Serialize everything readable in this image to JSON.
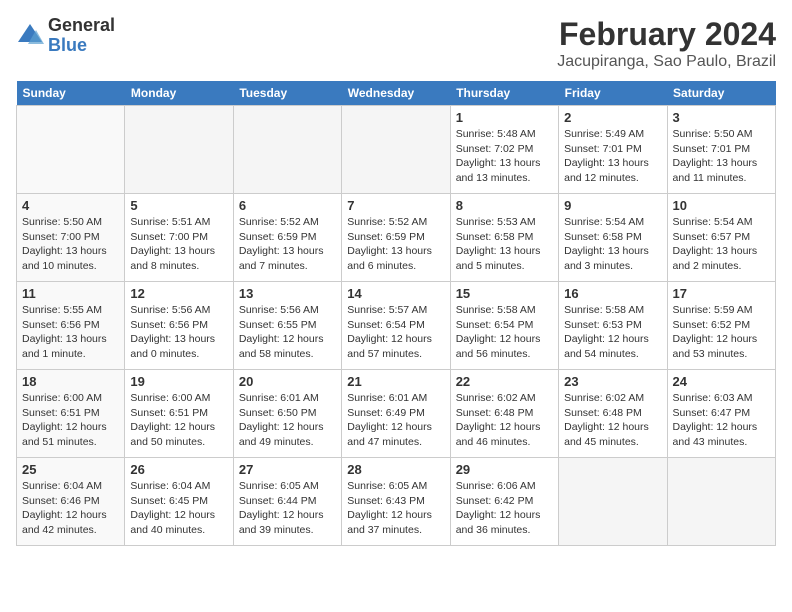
{
  "logo": {
    "general": "General",
    "blue": "Blue"
  },
  "title": "February 2024",
  "subtitle": "Jacupiranga, Sao Paulo, Brazil",
  "headers": [
    "Sunday",
    "Monday",
    "Tuesday",
    "Wednesday",
    "Thursday",
    "Friday",
    "Saturday"
  ],
  "weeks": [
    [
      {
        "day": "",
        "info": ""
      },
      {
        "day": "",
        "info": ""
      },
      {
        "day": "",
        "info": ""
      },
      {
        "day": "",
        "info": ""
      },
      {
        "day": "1",
        "info": "Sunrise: 5:48 AM\nSunset: 7:02 PM\nDaylight: 13 hours\nand 13 minutes."
      },
      {
        "day": "2",
        "info": "Sunrise: 5:49 AM\nSunset: 7:01 PM\nDaylight: 13 hours\nand 12 minutes."
      },
      {
        "day": "3",
        "info": "Sunrise: 5:50 AM\nSunset: 7:01 PM\nDaylight: 13 hours\nand 11 minutes."
      }
    ],
    [
      {
        "day": "4",
        "info": "Sunrise: 5:50 AM\nSunset: 7:00 PM\nDaylight: 13 hours\nand 10 minutes."
      },
      {
        "day": "5",
        "info": "Sunrise: 5:51 AM\nSunset: 7:00 PM\nDaylight: 13 hours\nand 8 minutes."
      },
      {
        "day": "6",
        "info": "Sunrise: 5:52 AM\nSunset: 6:59 PM\nDaylight: 13 hours\nand 7 minutes."
      },
      {
        "day": "7",
        "info": "Sunrise: 5:52 AM\nSunset: 6:59 PM\nDaylight: 13 hours\nand 6 minutes."
      },
      {
        "day": "8",
        "info": "Sunrise: 5:53 AM\nSunset: 6:58 PM\nDaylight: 13 hours\nand 5 minutes."
      },
      {
        "day": "9",
        "info": "Sunrise: 5:54 AM\nSunset: 6:58 PM\nDaylight: 13 hours\nand 3 minutes."
      },
      {
        "day": "10",
        "info": "Sunrise: 5:54 AM\nSunset: 6:57 PM\nDaylight: 13 hours\nand 2 minutes."
      }
    ],
    [
      {
        "day": "11",
        "info": "Sunrise: 5:55 AM\nSunset: 6:56 PM\nDaylight: 13 hours\nand 1 minute."
      },
      {
        "day": "12",
        "info": "Sunrise: 5:56 AM\nSunset: 6:56 PM\nDaylight: 13 hours\nand 0 minutes."
      },
      {
        "day": "13",
        "info": "Sunrise: 5:56 AM\nSunset: 6:55 PM\nDaylight: 12 hours\nand 58 minutes."
      },
      {
        "day": "14",
        "info": "Sunrise: 5:57 AM\nSunset: 6:54 PM\nDaylight: 12 hours\nand 57 minutes."
      },
      {
        "day": "15",
        "info": "Sunrise: 5:58 AM\nSunset: 6:54 PM\nDaylight: 12 hours\nand 56 minutes."
      },
      {
        "day": "16",
        "info": "Sunrise: 5:58 AM\nSunset: 6:53 PM\nDaylight: 12 hours\nand 54 minutes."
      },
      {
        "day": "17",
        "info": "Sunrise: 5:59 AM\nSunset: 6:52 PM\nDaylight: 12 hours\nand 53 minutes."
      }
    ],
    [
      {
        "day": "18",
        "info": "Sunrise: 6:00 AM\nSunset: 6:51 PM\nDaylight: 12 hours\nand 51 minutes."
      },
      {
        "day": "19",
        "info": "Sunrise: 6:00 AM\nSunset: 6:51 PM\nDaylight: 12 hours\nand 50 minutes."
      },
      {
        "day": "20",
        "info": "Sunrise: 6:01 AM\nSunset: 6:50 PM\nDaylight: 12 hours\nand 49 minutes."
      },
      {
        "day": "21",
        "info": "Sunrise: 6:01 AM\nSunset: 6:49 PM\nDaylight: 12 hours\nand 47 minutes."
      },
      {
        "day": "22",
        "info": "Sunrise: 6:02 AM\nSunset: 6:48 PM\nDaylight: 12 hours\nand 46 minutes."
      },
      {
        "day": "23",
        "info": "Sunrise: 6:02 AM\nSunset: 6:48 PM\nDaylight: 12 hours\nand 45 minutes."
      },
      {
        "day": "24",
        "info": "Sunrise: 6:03 AM\nSunset: 6:47 PM\nDaylight: 12 hours\nand 43 minutes."
      }
    ],
    [
      {
        "day": "25",
        "info": "Sunrise: 6:04 AM\nSunset: 6:46 PM\nDaylight: 12 hours\nand 42 minutes."
      },
      {
        "day": "26",
        "info": "Sunrise: 6:04 AM\nSunset: 6:45 PM\nDaylight: 12 hours\nand 40 minutes."
      },
      {
        "day": "27",
        "info": "Sunrise: 6:05 AM\nSunset: 6:44 PM\nDaylight: 12 hours\nand 39 minutes."
      },
      {
        "day": "28",
        "info": "Sunrise: 6:05 AM\nSunset: 6:43 PM\nDaylight: 12 hours\nand 37 minutes."
      },
      {
        "day": "29",
        "info": "Sunrise: 6:06 AM\nSunset: 6:42 PM\nDaylight: 12 hours\nand 36 minutes."
      },
      {
        "day": "",
        "info": ""
      },
      {
        "day": "",
        "info": ""
      }
    ]
  ]
}
